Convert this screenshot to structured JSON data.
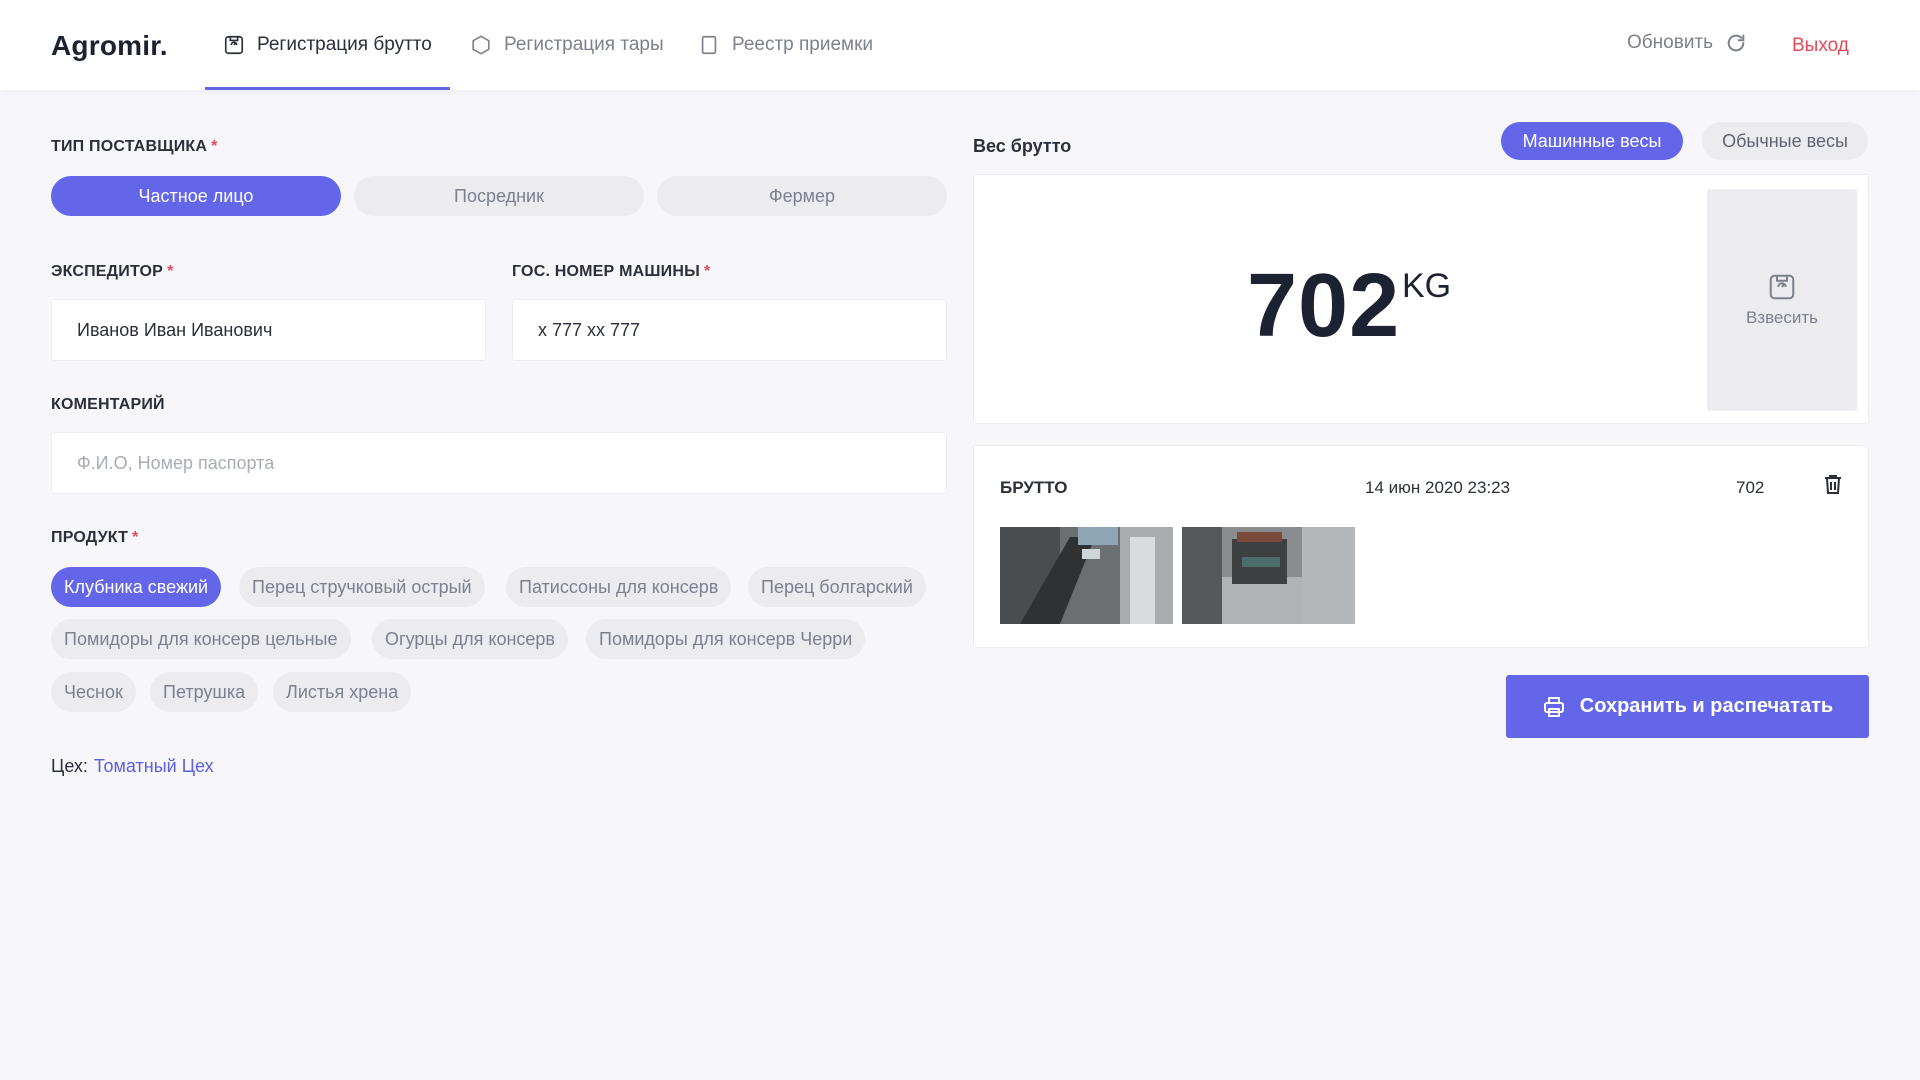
{
  "header": {
    "logo": "Agromir.",
    "tabs": [
      {
        "label": "Регистрация брутто",
        "icon": "scale-icon",
        "active": true
      },
      {
        "label": "Регистрация тары",
        "icon": "hexagon-icon",
        "active": false
      },
      {
        "label": "Реестр приемки",
        "icon": "bookmark-icon",
        "active": false
      }
    ],
    "refresh_label": "Обновить",
    "logout_label": "Выход"
  },
  "form": {
    "supplier_type": {
      "label": "ТИП ПОСТАВЩИКА",
      "required_mark": "*",
      "options": [
        "Частное лицо",
        "Посредник",
        "Фермер"
      ],
      "selected": "Частное лицо"
    },
    "forwarder": {
      "label": "ЭКСПЕДИТОР",
      "required_mark": "*",
      "value": "Иванов Иван Иванович"
    },
    "plate": {
      "label": "ГОС. НОМЕР МАШИНЫ",
      "required_mark": "*",
      "value": "х 777 хх 777"
    },
    "comment": {
      "label": "КОМЕНТАРИЙ",
      "placeholder": "Ф.И.О, Номер паспорта"
    },
    "product": {
      "label": "ПРОДУКТ",
      "required_mark": "*",
      "items": [
        "Клубника свежий",
        "Перец стручковый острый",
        "Патиссоны для консерв",
        "Перец болгарский",
        "Помидоры для консерв цельные",
        "Огурцы для консерв",
        "Помидоры для консерв Черри",
        "Чеснок",
        "Петрушка",
        "Листья хрена"
      ],
      "selected": "Клубника свежий"
    },
    "workshop": {
      "label": "Цех:",
      "value": "Томатный Цех"
    }
  },
  "weight": {
    "title": "Вес брутто",
    "scale_options": [
      "Машинные весы",
      "Обычные весы"
    ],
    "selected_scale": "Машинные весы",
    "value": "702",
    "unit": "KG",
    "weigh_button": "Взвесить"
  },
  "record": {
    "type": "БРУТТО",
    "date": "14 июн 2020 23:23",
    "value": "702"
  },
  "actions": {
    "save_print": "Сохранить и распечатать"
  },
  "colors": {
    "accent": "#6366e8",
    "danger": "#e5495a",
    "background": "#f7f7fb"
  }
}
